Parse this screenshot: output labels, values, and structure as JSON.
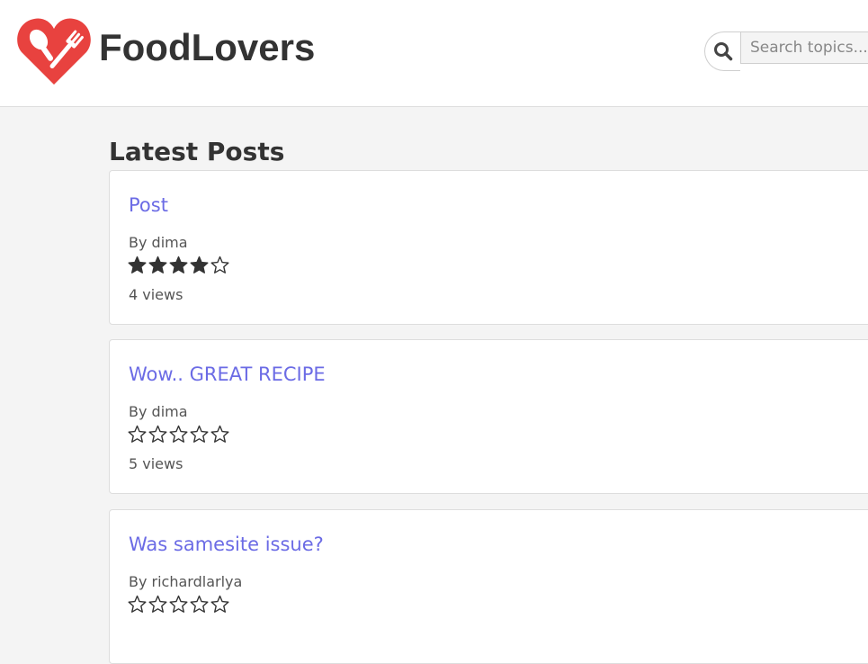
{
  "brand": {
    "name": "FoodLovers",
    "logo_color": "#e8423f"
  },
  "search": {
    "placeholder": "Search topics...",
    "icon": "search-icon"
  },
  "section_title": "Latest Posts",
  "posts": [
    {
      "title": "Post",
      "author": "By dima",
      "rating": 4,
      "max_rating": 5,
      "views": "4 views"
    },
    {
      "title": "Wow.. GREAT RECIPE",
      "author": "By dima",
      "rating": 0,
      "max_rating": 5,
      "views": "5 views"
    },
    {
      "title": "Was samesite issue?",
      "author": "By richardlarlya",
      "rating": 0,
      "max_rating": 5,
      "views": ""
    }
  ],
  "colors": {
    "link": "#6b6be5",
    "text": "#333333",
    "muted": "#555555",
    "background": "#f4f4f4"
  }
}
